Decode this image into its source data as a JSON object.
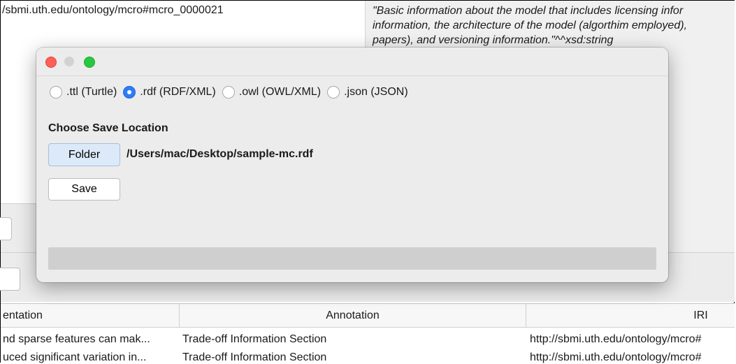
{
  "background": {
    "iri_text": "/sbmi.uth.edu/ontology/mcro#mcro_0000021",
    "description_lines": [
      "\"Basic information about the model that includes licensing infor",
      "information, the architecture of the model (algorthim employed),",
      "papers), and versioning information.\"^^xsd:string"
    ],
    "table": {
      "headers": [
        "entation",
        "Annotation",
        "IRI"
      ],
      "rows": [
        [
          "nd sparse features can mak...",
          "Trade-off Information Section",
          "http://sbmi.uth.edu/ontology/mcro#"
        ],
        [
          "uced significant variation in...",
          "Trade-off Information Section",
          "http://sbmi.uth.edu/ontology/mcro#"
        ]
      ]
    }
  },
  "dialog": {
    "formats": [
      {
        "label": ".ttl (Turtle)",
        "checked": false
      },
      {
        "label": ".rdf (RDF/XML)",
        "checked": true
      },
      {
        "label": ".owl (OWL/XML)",
        "checked": false
      },
      {
        "label": ".json (JSON)",
        "checked": false
      }
    ],
    "section_title": "Choose Save Location",
    "folder_button": "Folder",
    "save_path": "/Users/mac/Desktop/sample-mc.rdf",
    "save_button": "Save",
    "progress": 0,
    "colors": {
      "accent": "#2f7cf6",
      "close": "#fe5f57",
      "zoom": "#28c840"
    }
  }
}
